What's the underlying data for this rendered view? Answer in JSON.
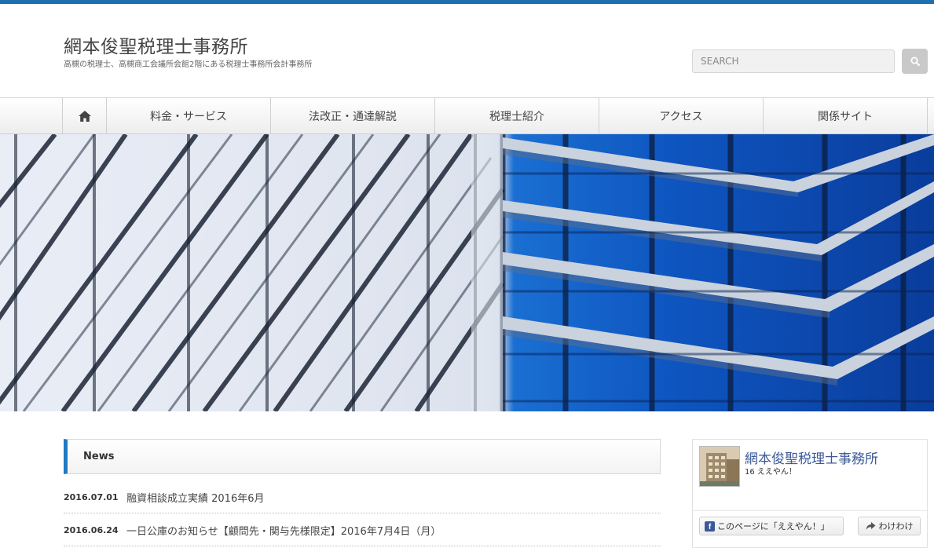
{
  "header": {
    "title": "網本俊聖税理士事務所",
    "description": "高槻の税理士、高槻商工会議所会館2階にある税理士事務所会計事務所"
  },
  "search": {
    "placeholder": "SEARCH",
    "icon": "search-icon"
  },
  "nav": {
    "home_icon": "home-icon",
    "items": [
      {
        "label": "料金・サービス"
      },
      {
        "label": "法改正・通達解説"
      },
      {
        "label": "税理士紹介"
      },
      {
        "label": "アクセス"
      },
      {
        "label": "関係サイト"
      }
    ]
  },
  "news": {
    "heading": "News",
    "items": [
      {
        "date": "2016.07.01",
        "title": "融資相談成立実績 2016年6月"
      },
      {
        "date": "2016.06.24",
        "title": "一日公庫のお知らせ【顧問先・関与先様限定】2016年7月4日（月）"
      }
    ]
  },
  "facebook": {
    "page_name": "網本俊聖税理士事務所",
    "likes": "16 ええやん！",
    "like_label": "このページに「ええやん！」",
    "share_label": "わけわけ",
    "colors": {
      "brand": "#3b5998"
    }
  },
  "colors": {
    "accent": "#1f6fae",
    "news_bar": "#1f79c2"
  }
}
